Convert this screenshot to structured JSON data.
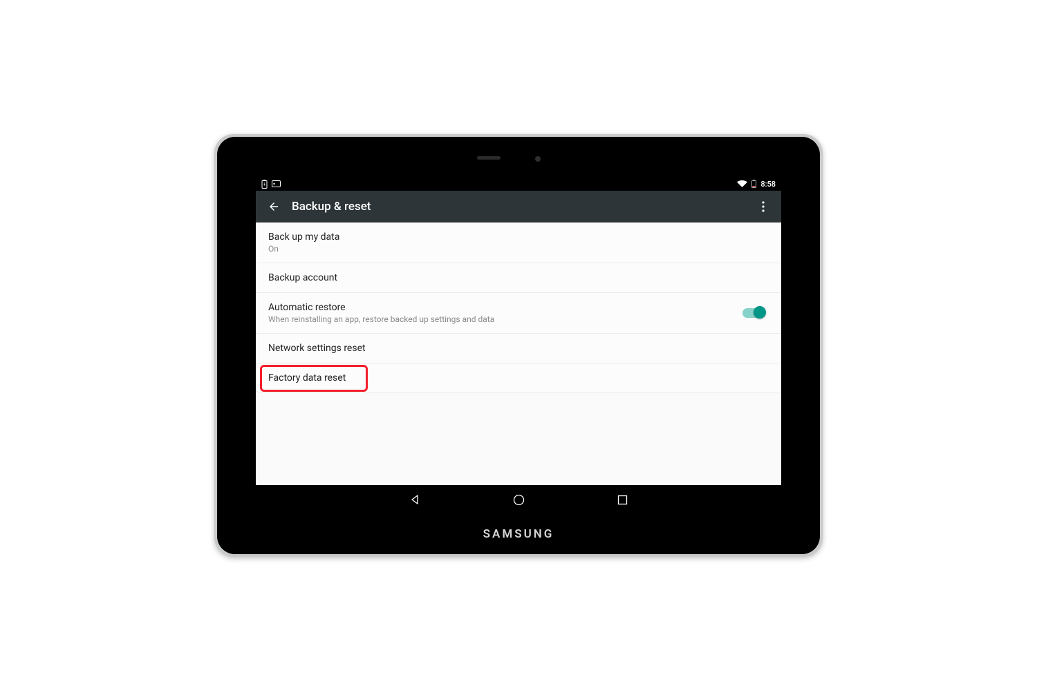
{
  "device": {
    "brand": "SAMSUNG"
  },
  "status": {
    "time": "8:58",
    "wifi_icon": "wifi",
    "battery_icon_left": "battery-charging",
    "sim_icon": "sim",
    "battery_icon_right": "battery-low"
  },
  "action_bar": {
    "title": "Backup & reset"
  },
  "items": [
    {
      "title": "Back up my data",
      "sub": "On",
      "toggle": false
    },
    {
      "title": "Backup account",
      "sub": "",
      "toggle": false
    },
    {
      "title": "Automatic restore",
      "sub": "When reinstalling an app, restore backed up settings and data",
      "toggle": true
    },
    {
      "title": "Network settings reset",
      "sub": "",
      "toggle": false
    },
    {
      "title": "Factory data reset",
      "sub": "",
      "toggle": false
    }
  ],
  "highlighted_item_index": 4,
  "colors": {
    "accent": "#009688",
    "actionbar": "#2d3538",
    "highlight": "#f21f2a"
  }
}
